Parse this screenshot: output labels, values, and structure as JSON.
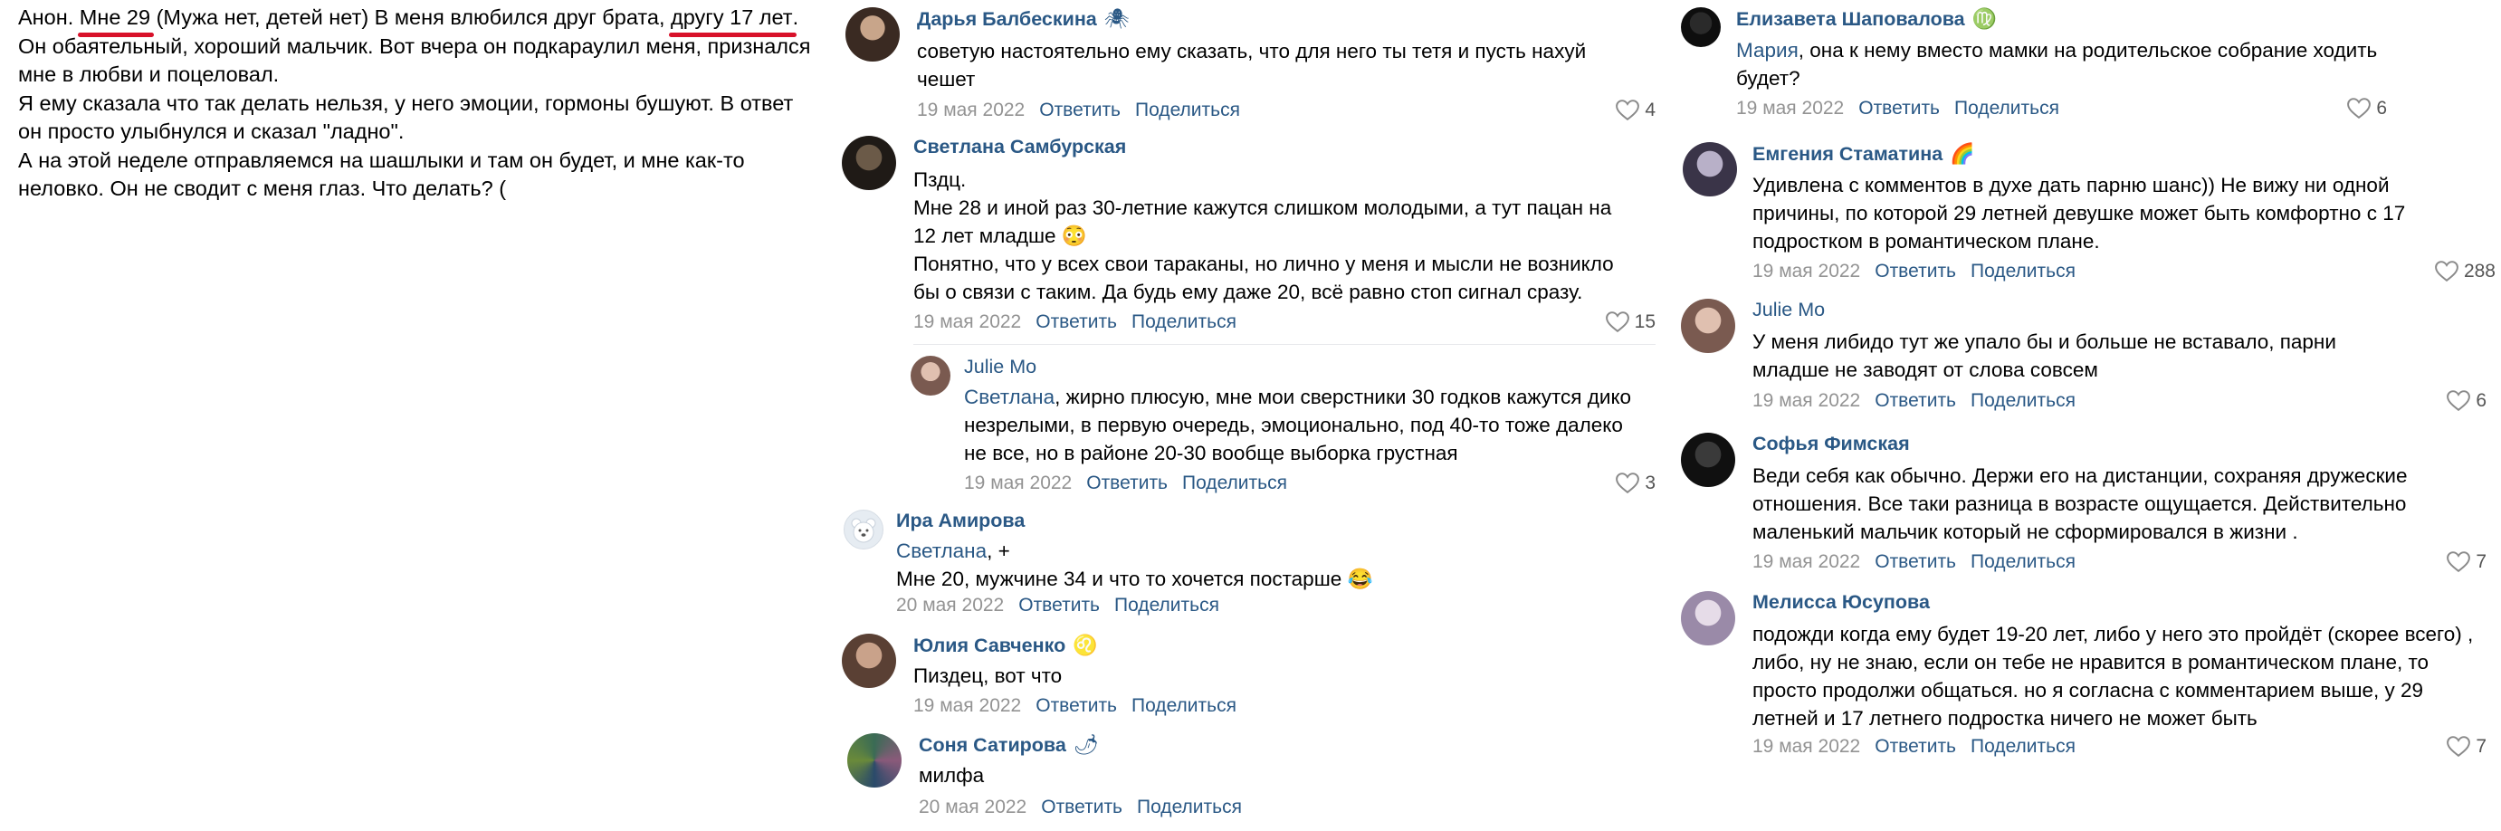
{
  "post": {
    "p1_pre": "Анон. ",
    "p1_u1": "Мне 29",
    "p1_mid": " (Мужа нет, детей нет) В меня влюбился друг брата, ",
    "p1_u2": "другу 17 лет",
    "p1_post": ". Он обаятельный,  хороший мальчик. Вот вчера он подкараулил меня, признался мне в любви и поцеловал.",
    "p2": "Я ему сказала что так делать нельзя, у него эмоции, гормоны бушуют. В ответ он просто улыбнулся и сказал \"ладно\".",
    "p3": "А на этой неделе отправляемся на шашлыки и там он будет, и мне как-то неловко. Он не сводит с меня глаз. Что делать? ("
  },
  "ui": {
    "reply": "Ответить",
    "share": "Поделиться"
  },
  "comments": {
    "darya": {
      "name": "Дарья Балбескина",
      "emoji": "🕷",
      "text": "советую настоятельно ему сказать, что для него ты тетя и пусть нахуй чешет",
      "date": "19 мая 2022",
      "likes": "4"
    },
    "svetlana": {
      "name": "Светлана Самбурская",
      "t1": "Пздц.",
      "t2": "Мне 28 и иной раз 30-летние кажутся слишком молодыми, а тут пацан на 12 лет младше 😳",
      "t3": "Понятно, что у всех свои тараканы, но лично у меня и мысли не возникло бы о связи с таким. Да будь ему даже 20, всё равно стоп сигнал сразу.",
      "date": "19 мая 2022",
      "likes": "15"
    },
    "julie1": {
      "name": "Julie Mo",
      "mention": "Светлана",
      "text": ", жирно плюсую, мне мои сверстники 30 годков кажутся дико незрелыми, в первую очередь, эмоционально, под 40-то тоже далеко не все, но в районе 20-30 вообще выборка грустная",
      "date": "19 мая 2022",
      "likes": "3"
    },
    "ira": {
      "name": "Ира Амирова",
      "mention": "Светлана",
      "mention_rest": ", +",
      "text": "Мне 20, мужчине 34 и что то хочется постарше 😂",
      "date": "20 мая 2022"
    },
    "yulia": {
      "name": "Юлия Савченко",
      "emoji": "♌",
      "text": "Пиздец, вот что",
      "date": "19 мая 2022"
    },
    "sonya": {
      "name": "Соня Сатирова",
      "emoji": "🌶",
      "text": "милфа",
      "date": "20 мая 2022"
    },
    "elizaveta": {
      "name": "Елизавета Шаповалова",
      "emoji": "♍",
      "mention": "Мария",
      "text": ", она к нему вместо мамки на родительское собрание ходить будет?",
      "date": "19 мая 2022",
      "likes": "6"
    },
    "evgeniya": {
      "name": "Емгения Стаматина",
      "emoji": "🌈",
      "text": "Удивлена с комментов в духе дать парню шанс)) Не вижу ни одной причины, по которой 29 летней девушке может быть комфортно с 17 подростком в романтическом плане.",
      "date": "19 мая 2022",
      "likes": "288"
    },
    "julie2": {
      "name": "Julie Mo",
      "text": "У меня либидо тут же упало бы и больше не вставало, парни младше не заводят от слова совсем",
      "date": "19 мая 2022",
      "likes": "6"
    },
    "sofya": {
      "name": "Софья Фимская",
      "text": "Веди себя как обычно. Держи его на дистанции, сохраняя дружеские отношения. Все таки разница в возрасте ощущается. Действительно маленький мальчик который не сформировался в жизни .",
      "date": "19 мая 2022",
      "likes": "7"
    },
    "melissa": {
      "name": "Мелисса Юсупова",
      "text": "подожди когда ему будет 19-20 лет, либо у него это пройдёт (скорее всего) , либо, ну не знаю, если он тебе не нравится в романтическом плане, то просто продолжи общаться. но я согласна с комментарием выше, у 29 летней и 17 летнего подростка ничего не может быть",
      "date": "19 мая 2022",
      "likes": "7"
    }
  },
  "colors": {
    "link": "#2a5885",
    "date": "#939393",
    "underline": "#d8112a"
  }
}
